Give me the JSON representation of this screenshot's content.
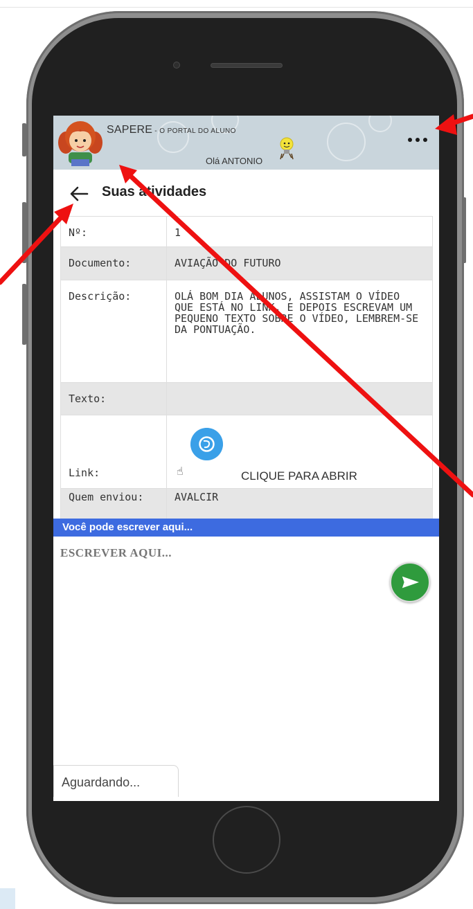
{
  "header": {
    "app_title": "SAPERE",
    "app_subtitle": " - O PORTAL DO ALUNO",
    "greeting": "Olá ANTONIO",
    "avatar_icon": "student-girl-avatar-icon",
    "bulb_icon": "lightbulb-character-icon",
    "menu_icon": "more-dots-icon"
  },
  "page": {
    "title": "Suas atividades",
    "back_icon": "arrow-left-icon"
  },
  "details": {
    "rows": [
      {
        "label": "Nº:",
        "value": "1"
      },
      {
        "label": "Documento:",
        "value": "AVIAÇÃO DO FUTURO"
      },
      {
        "label": "Descrição:",
        "value": "OLÁ BOM DIA ALUNOS, ASSISTAM O VÍDEO QUE ESTÁ NO LINK, E DEPOIS ESCREVAM UM PEQUENO TEXTO SOBRE O VÍDEO, LEMBREM-SE DA PONTUAÇÃO."
      },
      {
        "label": "Texto:",
        "value": ""
      },
      {
        "label": "Link:",
        "value": "CLIQUE PARA ABRIR"
      },
      {
        "label": "Quem enviou:",
        "value": "AVALCIR"
      }
    ]
  },
  "compose": {
    "band_label": "Você pode escrever aqui...",
    "placeholder": "ESCREVER AQUI...",
    "send_icon": "send-arrow-icon"
  },
  "status": {
    "text": "Aguardando..."
  },
  "colors": {
    "header_bg": "#c9d5dc",
    "band_bg": "#3d6be0",
    "send_bg": "#2f9b3d",
    "link_icon_bg": "#3aa0e8",
    "annotation_arrow": "#ee1111"
  }
}
